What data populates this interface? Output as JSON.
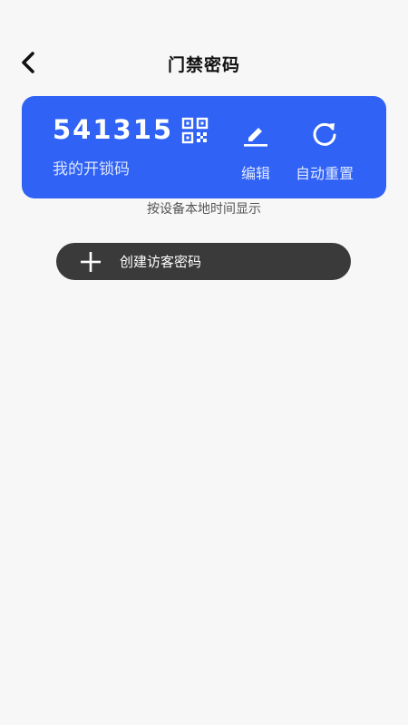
{
  "header": {
    "title": "门禁密码"
  },
  "code_card": {
    "code": "541315",
    "label": "我的开锁码",
    "actions": {
      "edit_label": "编辑",
      "reset_label": "自动重置"
    }
  },
  "hint": "按设备本地时间显示",
  "create_button": {
    "label": "创建访客密码"
  },
  "colors": {
    "background": "#f7f7f7",
    "card_accent": "#2f62f5",
    "create_button_bg": "#3a3a3a"
  },
  "icons": {
    "back": "chevron-left-icon",
    "qr": "qr-code-icon",
    "edit": "pencil-icon",
    "reset": "refresh-icon",
    "add": "plus-icon"
  }
}
